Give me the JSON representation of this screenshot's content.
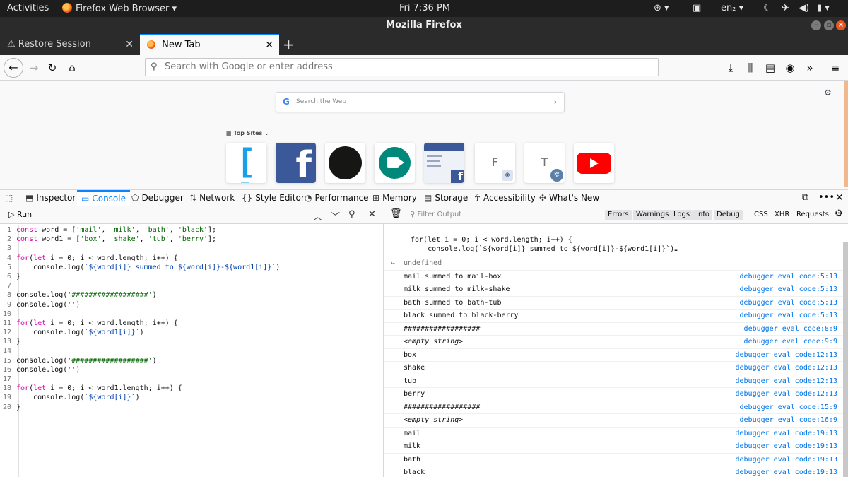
{
  "topbar": {
    "activities": "Activities",
    "app_name": "Firefox Web Browser",
    "clock": "Fri  7:36 PM",
    "lang": "en₂"
  },
  "window": {
    "title": "Mozilla Firefox"
  },
  "tabs": [
    {
      "label": "Restore Session"
    },
    {
      "label": "New Tab"
    }
  ],
  "urlbar": {
    "placeholder": "Search with Google or enter address"
  },
  "newtab": {
    "search_placeholder": "Search the Web",
    "top_sites_label": "Top Sites",
    "sites": [
      "Brackets",
      "Facebook",
      "GitHub",
      "Google Meet",
      "Facebook for Developers",
      "F",
      "T",
      "YouTube"
    ]
  },
  "devtools": {
    "tabs": [
      "Inspector",
      "Console",
      "Debugger",
      "Network",
      "Style Editor",
      "Performance",
      "Memory",
      "Storage",
      "Accessibility",
      "What's New"
    ]
  },
  "editor": {
    "run_label": "Run",
    "lines": [
      {
        "n": "1",
        "html": "<span class=\"kw\">const</span> word = [<span class=\"str\">'mail'</span>, <span class=\"str\">'milk'</span>, <span class=\"str\">'bath'</span>, <span class=\"str\">'black'</span>];"
      },
      {
        "n": "2",
        "html": "<span class=\"kw\">const</span> word1 = [<span class=\"str\">'box'</span>, <span class=\"str\">'shake'</span>, <span class=\"str\">'tub'</span>, <span class=\"str\">'berry'</span>];"
      },
      {
        "n": "3",
        "html": ""
      },
      {
        "n": "4",
        "html": "<span class=\"kw\">for</span>(<span class=\"kw\">let</span> i = 0; i &lt; word.length; i++) {"
      },
      {
        "n": "5",
        "html": "    console.log(<span class=\"tmpl\">`${word[i]} summed to ${word[i]}-${word1[i]}`</span>)"
      },
      {
        "n": "6",
        "html": "}"
      },
      {
        "n": "7",
        "html": ""
      },
      {
        "n": "8",
        "html": "console.log(<span class=\"str\">'##################'</span>)"
      },
      {
        "n": "9",
        "html": "console.log(<span class=\"str\">''</span>)"
      },
      {
        "n": "10",
        "html": ""
      },
      {
        "n": "11",
        "html": "<span class=\"kw\">for</span>(<span class=\"kw\">let</span> i = 0; i &lt; word.length; i++) {"
      },
      {
        "n": "12",
        "html": "    console.log(<span class=\"tmpl\">`${word1[i]}`</span>)"
      },
      {
        "n": "13",
        "html": "}"
      },
      {
        "n": "14",
        "html": ""
      },
      {
        "n": "15",
        "html": "console.log(<span class=\"str\">'##################'</span>)"
      },
      {
        "n": "16",
        "html": "console.log(<span class=\"str\">''</span>)"
      },
      {
        "n": "17",
        "html": ""
      },
      {
        "n": "18",
        "html": "<span class=\"kw\">for</span>(<span class=\"kw\">let</span> i = 0; i &lt; word1.length; i++) {"
      },
      {
        "n": "19",
        "html": "    console.log(<span class=\"tmpl\">`${word[i]}`</span>)"
      },
      {
        "n": "20",
        "html": "}"
      }
    ]
  },
  "console": {
    "filter_placeholder": "Filter Output",
    "filters": [
      "Errors",
      "Warnings",
      "Logs",
      "Info",
      "Debug"
    ],
    "net_filters": [
      "CSS",
      "XHR",
      "Requests"
    ],
    "echo_line1": "for(let i = 0; i < word.length; i++) {",
    "echo_line2": "    console.log(`${word[i]} summed to ${word[i]}-${word1[i]}`)…",
    "result": "undefined",
    "messages": [
      {
        "text": "mail summed to mail-box",
        "loc": "debugger eval code:5:13"
      },
      {
        "text": "milk summed to milk-shake",
        "loc": "debugger eval code:5:13"
      },
      {
        "text": "bath summed to bath-tub",
        "loc": "debugger eval code:5:13"
      },
      {
        "text": "black summed to black-berry",
        "loc": "debugger eval code:5:13"
      },
      {
        "text": "##################",
        "loc": "debugger eval code:8:9"
      },
      {
        "text": "<empty string>",
        "loc": "debugger eval code:9:9",
        "italic": true
      },
      {
        "text": "box",
        "loc": "debugger eval code:12:13"
      },
      {
        "text": "shake",
        "loc": "debugger eval code:12:13"
      },
      {
        "text": "tub",
        "loc": "debugger eval code:12:13"
      },
      {
        "text": "berry",
        "loc": "debugger eval code:12:13"
      },
      {
        "text": "##################",
        "loc": "debugger eval code:15:9"
      },
      {
        "text": "<empty string>",
        "loc": "debugger eval code:16:9",
        "italic": true
      },
      {
        "text": "mail",
        "loc": "debugger eval code:19:13"
      },
      {
        "text": "milk",
        "loc": "debugger eval code:19:13"
      },
      {
        "text": "bath",
        "loc": "debugger eval code:19:13"
      },
      {
        "text": "black",
        "loc": "debugger eval code:19:13"
      }
    ]
  }
}
